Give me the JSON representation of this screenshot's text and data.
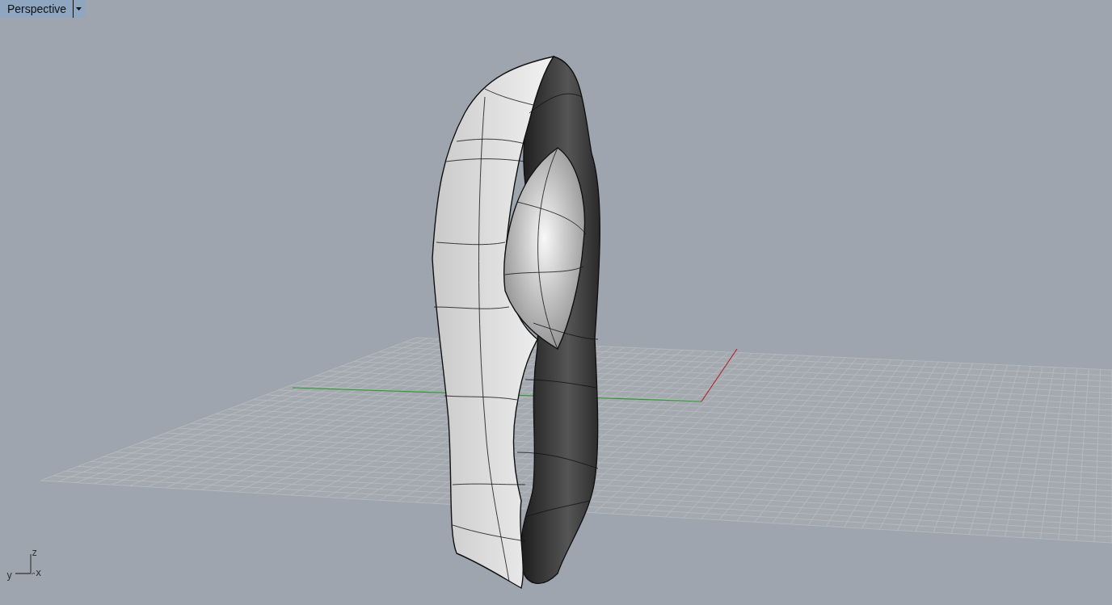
{
  "viewport": {
    "title": "Perspective"
  },
  "axis_indicator": {
    "z": "z",
    "y": "y",
    "x": "x"
  }
}
